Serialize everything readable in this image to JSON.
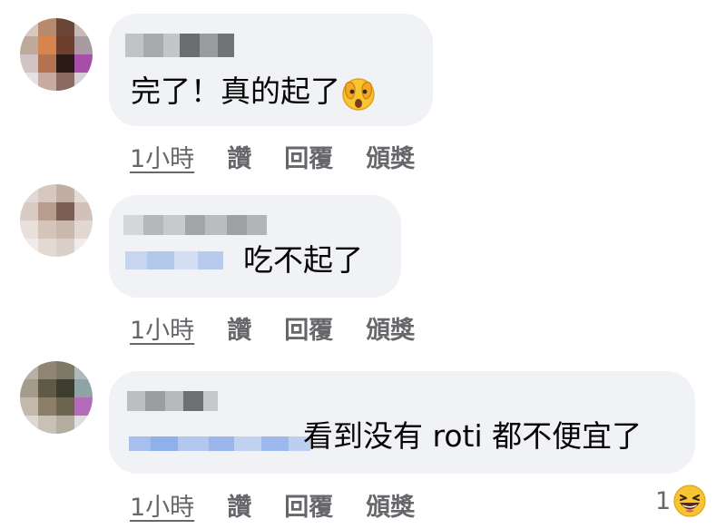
{
  "comments": [
    {
      "text": "完了！真的起了",
      "emoji": "face-with-peeking-eye-icon",
      "actions": {
        "time": "1小時",
        "like": "讚",
        "reply": "回覆",
        "award": "頒獎"
      }
    },
    {
      "text": "吃不起了",
      "actions": {
        "time": "1小時",
        "like": "讚",
        "reply": "回覆",
        "award": "頒獎"
      }
    },
    {
      "text": "看到没有 roti 都不便宜了",
      "actions": {
        "time": "1小時",
        "like": "讚",
        "reply": "回覆",
        "award": "頒獎"
      },
      "reaction": {
        "count": "1",
        "emoji": "laughing-face-icon"
      }
    }
  ],
  "colors": {
    "bubble": "#f0f2f5",
    "meta": "#65676b",
    "text": "#050505"
  }
}
